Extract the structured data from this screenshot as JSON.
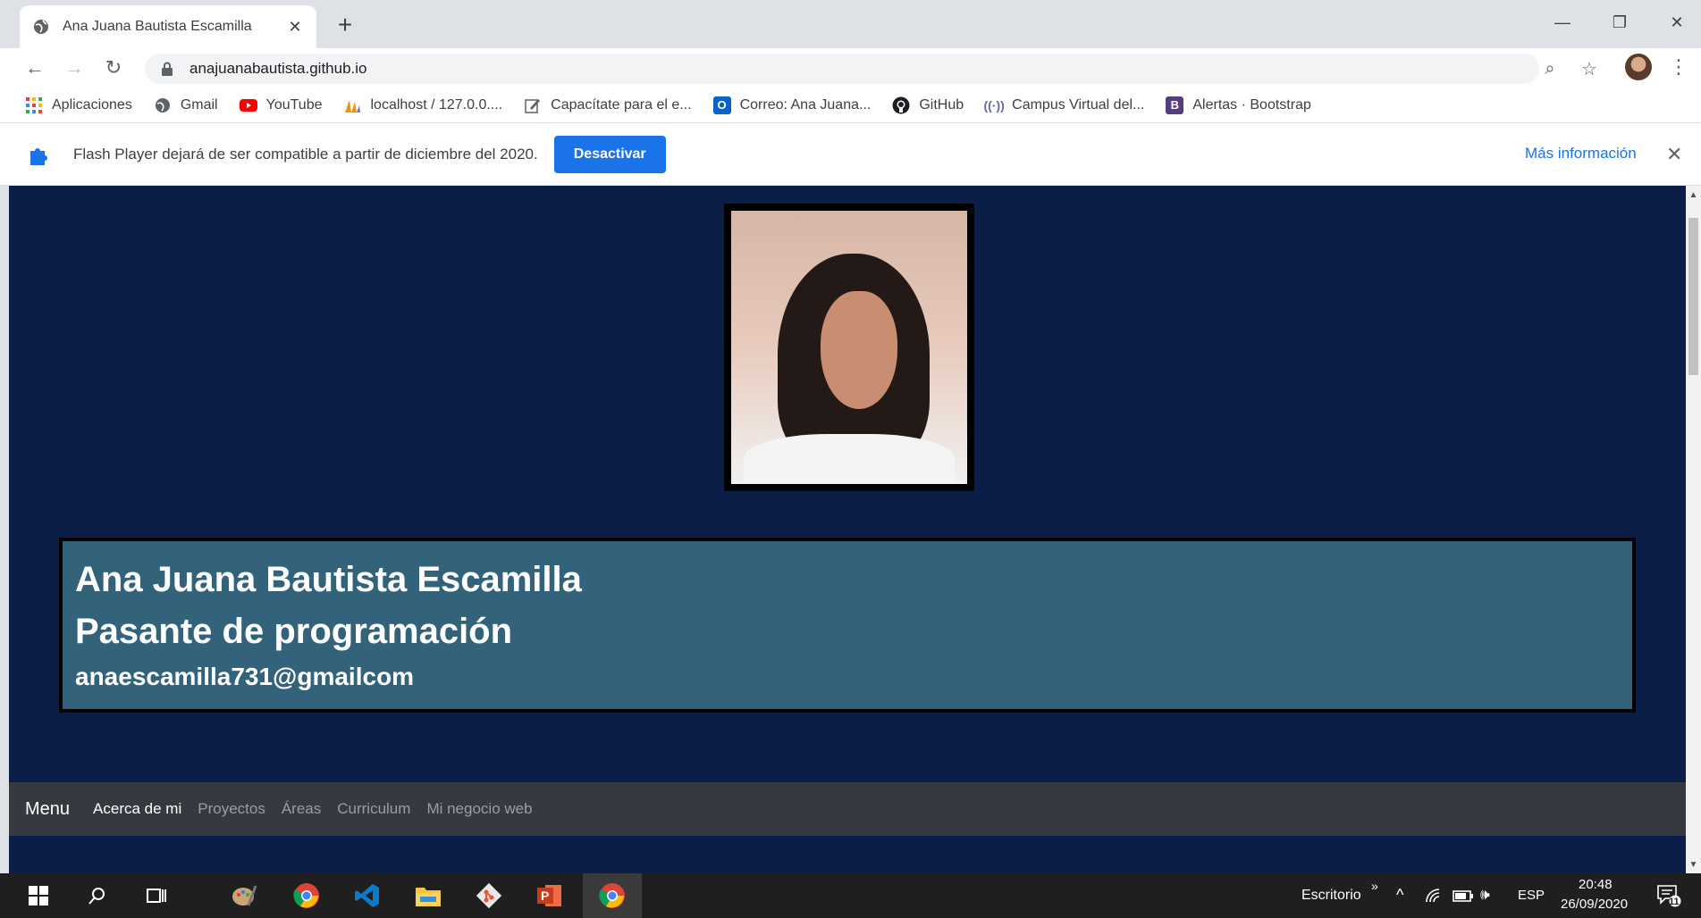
{
  "browser": {
    "tab_title": "Ana Juana Bautista Escamilla",
    "url": "anajuanabautista.github.io"
  },
  "bookmarks": [
    {
      "label": "Aplicaciones",
      "icon": "apps-grid-icon"
    },
    {
      "label": "Gmail",
      "icon": "globe-icon"
    },
    {
      "label": "YouTube",
      "icon": "youtube-icon"
    },
    {
      "label": "localhost / 127.0.0....",
      "icon": "phpmyadmin-icon"
    },
    {
      "label": "Capacítate para el e...",
      "icon": "edit-icon"
    },
    {
      "label": "Correo: Ana Juana...",
      "icon": "outlook-icon"
    },
    {
      "label": "GitHub",
      "icon": "github-icon"
    },
    {
      "label": "Campus Virtual del...",
      "icon": "broadcast-icon"
    },
    {
      "label": "Alertas · Bootstrap",
      "icon": "bootstrap-icon"
    }
  ],
  "infobar": {
    "message": "Flash Player dejará de ser compatible a partir de diciembre del 2020.",
    "button": "Desactivar",
    "more": "Más información"
  },
  "profile": {
    "name": "Ana Juana Bautista Escamilla",
    "role": "Pasante de programación",
    "email": "anaescamilla731@gmailcom"
  },
  "navbar": {
    "brand": "Menu",
    "links": [
      "Acerca de mi",
      "Proyectos",
      "Áreas",
      "Curriculum",
      "Mi negocio web"
    ]
  },
  "taskbar": {
    "desktop": "Escritorio",
    "lang": "ESP",
    "time": "20:48",
    "date": "26/09/2020",
    "notifications": "11"
  },
  "colors": {
    "page_bg": "#0a1e47",
    "info_box_bg": "#32637a",
    "navbar_bg": "#343a40",
    "accent_blue": "#1a73e8"
  }
}
